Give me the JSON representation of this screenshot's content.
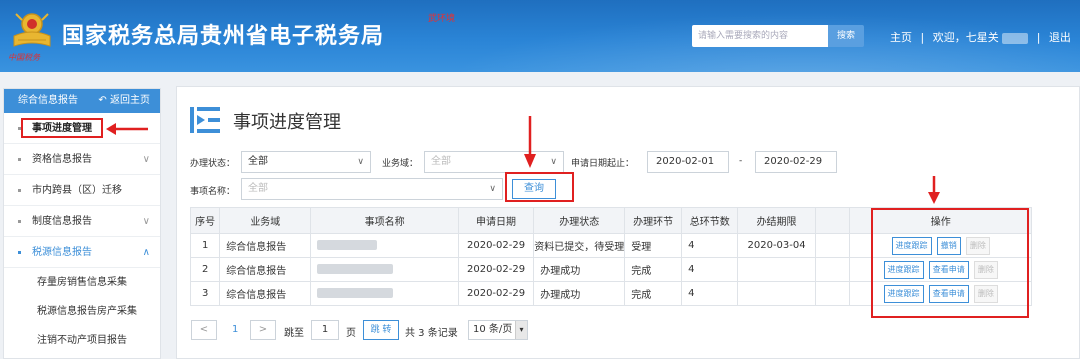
{
  "header": {
    "title": "国家税务总局贵州省电子税务局",
    "env_tag": "武环境",
    "emblem_text": "中国税务",
    "search_placeholder": "请输入需要搜索的内容",
    "search_button": "搜索",
    "nav_home": "主页",
    "nav_sep1": "|",
    "welcome": "欢迎，七星关",
    "nav_sep2": "|",
    "logout": "退出"
  },
  "sidebar": {
    "head_title": "综合信息报告",
    "back_label": "返回主页",
    "items": [
      {
        "label": "事项进度管理",
        "chevron": ""
      },
      {
        "label": "资格信息报告",
        "chevron": "∨"
      },
      {
        "label": "市内跨县（区）迁移",
        "chevron": ""
      },
      {
        "label": "制度信息报告",
        "chevron": "∨"
      },
      {
        "label": "税源信息报告",
        "chevron": "∧"
      }
    ],
    "subitems": [
      "存量房销售信息采集",
      "税源信息报告房产采集",
      "注销不动产项目报告"
    ]
  },
  "main": {
    "title": "事项进度管理",
    "filters": {
      "status_label": "办理状态：",
      "status_value": "全部",
      "domain_label": "业务域：",
      "domain_value": "全部",
      "date_label": "申请日期起止：",
      "date_from": "2020-02-01",
      "date_dash": "-",
      "date_to": "2020-02-29",
      "name_label": "事项名称：",
      "name_value": "全部",
      "query_button": "查询"
    },
    "table": {
      "headers": [
        "序号",
        "业务域",
        "事项名称",
        "申请日期",
        "办理状态",
        "办理环节",
        "总环节数",
        "办结期限",
        "",
        "操作"
      ],
      "rows": [
        {
          "no": "1",
          "domain": "综合信息报告",
          "date": "2020-02-29",
          "status": "资料已提交，待受理",
          "step": "受理",
          "total": "4",
          "deadline": "2020-03-04",
          "ops": [
            "进度跟踪",
            "撤销",
            "删除"
          ]
        },
        {
          "no": "2",
          "domain": "综合信息报告",
          "date": "2020-02-29",
          "status": "办理成功",
          "step": "完成",
          "total": "4",
          "deadline": "",
          "ops": [
            "进度跟踪",
            "查看申请",
            "删除"
          ]
        },
        {
          "no": "3",
          "domain": "综合信息报告",
          "date": "2020-02-29",
          "status": "办理成功",
          "step": "完成",
          "total": "4",
          "deadline": "",
          "ops": [
            "进度跟踪",
            "查看申请",
            "删除"
          ]
        }
      ]
    },
    "pagination": {
      "prev": "<",
      "current_page": "1",
      "next": ">",
      "goto_label": "跳至",
      "goto_value": "1",
      "page_unit": "页",
      "jump_button": "跳 转",
      "total_text": "共 3 条记录",
      "page_size": "10 条/页",
      "page_size_caret": "▾"
    }
  },
  "colors": {
    "header_blue": "#2a84d6",
    "accent_blue": "#3d8fd8",
    "annotation_red": "#e02020"
  },
  "icons": {
    "back": "undo-arrow-icon",
    "emblem": "tax-emblem-icon",
    "page": "list-icon"
  }
}
